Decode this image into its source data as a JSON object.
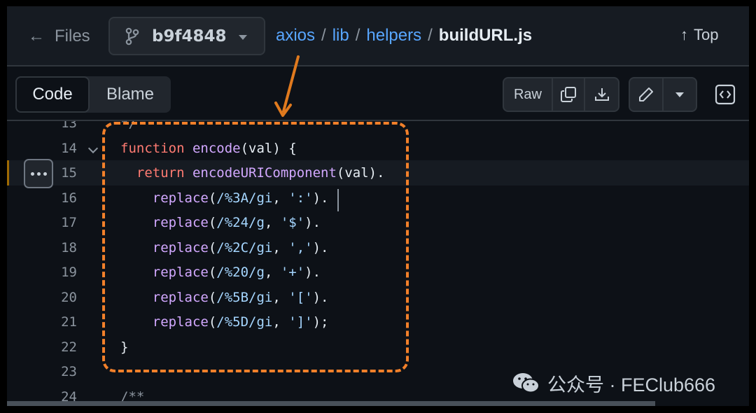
{
  "header": {
    "back_label": "Files",
    "branch": "b9f4848",
    "breadcrumb": [
      "axios",
      "lib",
      "helpers"
    ],
    "separator": "/",
    "file": "buildURL.js",
    "top_label": "Top"
  },
  "toolbar": {
    "tabs": [
      "Code",
      "Blame"
    ],
    "raw_label": "Raw"
  },
  "code": {
    "lines": [
      {
        "n": "13",
        "segs": [
          [
            "cm",
            "*/"
          ]
        ]
      },
      {
        "n": "14",
        "segs": [
          [
            "kw",
            "function"
          ],
          [
            "pl",
            " "
          ],
          [
            "fn",
            "encode"
          ],
          [
            "pl",
            "(val) {"
          ]
        ]
      },
      {
        "n": "15",
        "segs": [
          [
            "pl",
            "  "
          ],
          [
            "kw",
            "return"
          ],
          [
            "pl",
            " "
          ],
          [
            "fn",
            "encodeURIComponent"
          ],
          [
            "pl",
            "(val)."
          ]
        ]
      },
      {
        "n": "16",
        "segs": [
          [
            "pl",
            "    "
          ],
          [
            "fn",
            "replace"
          ],
          [
            "pl",
            "("
          ],
          [
            "str",
            "/%3A/gi"
          ],
          [
            "pl",
            ", "
          ],
          [
            "str",
            "':'"
          ],
          [
            "pl",
            ")."
          ]
        ]
      },
      {
        "n": "17",
        "segs": [
          [
            "pl",
            "    "
          ],
          [
            "fn",
            "replace"
          ],
          [
            "pl",
            "("
          ],
          [
            "str",
            "/%24/g"
          ],
          [
            "pl",
            ", "
          ],
          [
            "str",
            "'$'"
          ],
          [
            "pl",
            ")."
          ]
        ]
      },
      {
        "n": "18",
        "segs": [
          [
            "pl",
            "    "
          ],
          [
            "fn",
            "replace"
          ],
          [
            "pl",
            "("
          ],
          [
            "str",
            "/%2C/gi"
          ],
          [
            "pl",
            ", "
          ],
          [
            "str",
            "','"
          ],
          [
            "pl",
            ")."
          ]
        ]
      },
      {
        "n": "19",
        "segs": [
          [
            "pl",
            "    "
          ],
          [
            "fn",
            "replace"
          ],
          [
            "pl",
            "("
          ],
          [
            "str",
            "/%20/g"
          ],
          [
            "pl",
            ", "
          ],
          [
            "str",
            "'+'"
          ],
          [
            "pl",
            ")."
          ]
        ]
      },
      {
        "n": "20",
        "segs": [
          [
            "pl",
            "    "
          ],
          [
            "fn",
            "replace"
          ],
          [
            "pl",
            "("
          ],
          [
            "str",
            "/%5B/gi"
          ],
          [
            "pl",
            ", "
          ],
          [
            "str",
            "'['"
          ],
          [
            "pl",
            ")."
          ]
        ]
      },
      {
        "n": "21",
        "segs": [
          [
            "pl",
            "    "
          ],
          [
            "fn",
            "replace"
          ],
          [
            "pl",
            "("
          ],
          [
            "str",
            "/%5D/gi"
          ],
          [
            "pl",
            ", "
          ],
          [
            "str",
            "']'"
          ],
          [
            "pl",
            ");"
          ]
        ]
      },
      {
        "n": "22",
        "segs": [
          [
            "pl",
            "}"
          ]
        ]
      },
      {
        "n": "23",
        "segs": []
      },
      {
        "n": "24",
        "segs": [
          [
            "cm",
            "/**"
          ]
        ]
      }
    ],
    "highlighted_line": "15"
  },
  "watermark": {
    "text": "公众号 · FEClub666"
  },
  "colors": {
    "annotation": "#f2802a",
    "link": "#58a6ff",
    "keyword": "#ff7b72",
    "function": "#d2a8ff",
    "string": "#a5d6ff"
  }
}
